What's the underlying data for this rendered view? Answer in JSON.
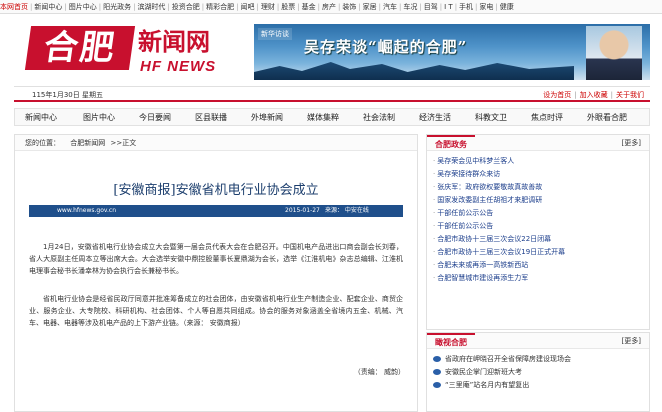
{
  "topnav": [
    "本网首页",
    "新闻中心",
    "图片中心",
    "阳光政务",
    "滨湖时代",
    "投资合肥",
    "精彩合肥",
    "闻吧",
    "理财",
    "股票",
    "基金",
    "房产",
    "装饰",
    "家居",
    "汽车",
    "车况",
    "目驾",
    "I T",
    "手机",
    "家电",
    "健康"
  ],
  "logo": {
    "cn": "合肥",
    "cn2": "新闻网",
    "en": "HF NEWS"
  },
  "banner": {
    "tag": "新华访谈",
    "title": "吴存荣谈“崛起的合肥”"
  },
  "datebar": {
    "date": "115年1月30日 星期五",
    "links": [
      "设为首页",
      "加入收藏",
      "关于我们"
    ]
  },
  "channels": [
    "新闻中心",
    "图片中心",
    "今日要闻",
    "区县联播",
    "外埠新闻",
    "媒体集粹",
    "社会法制",
    "经济生活",
    "科教文卫",
    "焦点时评",
    "外眼看合肥"
  ],
  "breadcrumb": {
    "label": "您的位置：",
    "site": "合肥新闻网",
    "tail": ">>正文"
  },
  "article": {
    "title": "[安徽商报]安徽省机电行业协会成立",
    "site_url": "www.hfnews.gov.cn",
    "time": "2015-01-27",
    "source": "来源： 中安在线",
    "p1": "1月24日，安徽省机电行业协会成立大会暨第一届会员代表大会在合肥召开。中国机电产品进出口商会副会长刘春，省人大原副主任周本立等出席大会。大会选举安徽中鼎控股董事长夏鼎湖为会长，选举《江淮机电》杂志总编辑、江淮机电理事会秘书长潘幸林为协会执行会长兼秘书长。",
    "p2": "省机电行业协会是经省民政厅同意并批准筹备成立的社会团体，由安徽省机电行业生产制造企业、配套企业、商贸企业、服务企业、大专院校、科研机构、社会团体、个人等自愿共同组成。协会的服务对象涵盖全省境内五金、机械、汽车、电器、电器等涉及机电产品的上下游产业链。（来源： 安徽商报）",
    "editor": "（责编： 威韵）"
  },
  "politics": {
    "title": "合肥政务",
    "more": "[更多]",
    "items": [
      "吴存荣会见中科梦兰客人",
      "吴存荣接待群众来访",
      "张庆军：政府欲权要敬故真故善故",
      "国家发改委副主任胡祖才来肥调研",
      "干部任前公示公告",
      "干部任前公示公告",
      "合肥市政协十三届三次会议22日闭幕",
      "合肥市政协十三届三次会议19日正式开幕",
      "合肥未来或再添一高铁新西站",
      "合肥智慧城市建设再添生力军"
    ]
  },
  "gallery": {
    "title": "瞰视合肥",
    "more": "[更多]",
    "items": [
      "省政府在岬晓召开全省保障房建设现场会",
      "安徽民企掌门迎新班大考",
      "“三里庵”站名月内有望复出"
    ]
  }
}
